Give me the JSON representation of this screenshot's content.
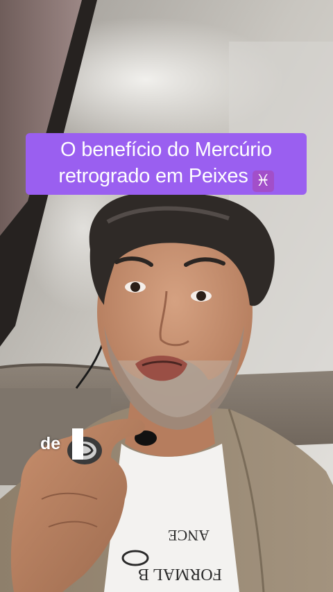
{
  "caption": {
    "line1": "O benefício do Mercúrio",
    "line2": "retrogrado em Peixes",
    "emoji": "♓"
  },
  "subtitle": {
    "word": "de"
  },
  "colors": {
    "caption_background": "#9a5ff0",
    "emoji_badge": "#a24fc9",
    "caption_text": "#ffffff"
  },
  "shirt_print": {
    "line1": "ANCE",
    "line2": "FORMAL B"
  }
}
